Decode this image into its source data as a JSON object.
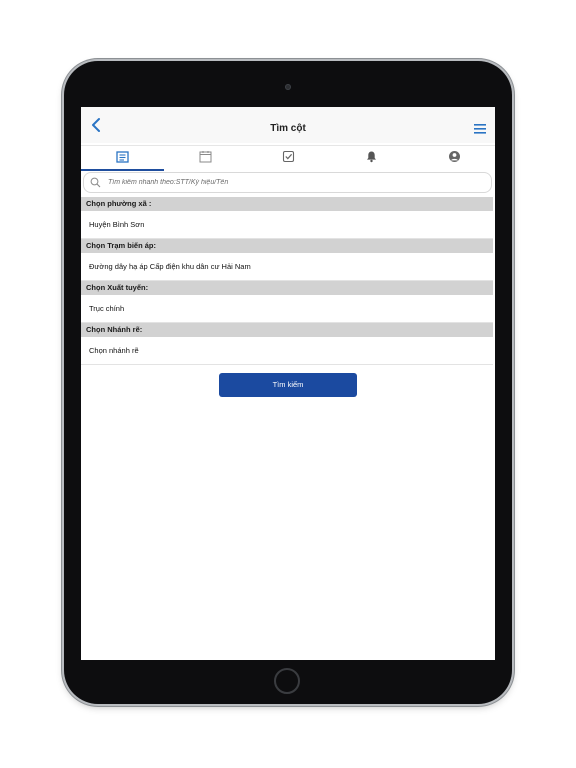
{
  "header": {
    "title": "Tìm cột",
    "back_icon": "chevron-left-icon",
    "menu_icon": "hamburger-menu-icon"
  },
  "tabs": [
    {
      "icon": "document-list-icon",
      "active": true
    },
    {
      "icon": "calendar-icon",
      "active": false
    },
    {
      "icon": "checkbox-icon",
      "active": false
    },
    {
      "icon": "bell-icon",
      "active": false
    },
    {
      "icon": "user-circle-icon",
      "active": false
    }
  ],
  "search": {
    "placeholder": "Tìm kiếm nhanh theo:STT/Ký hiệu/Tên",
    "value": ""
  },
  "fields": [
    {
      "label": "Chọn phường xã :",
      "value": "Huyện Bình Sơn"
    },
    {
      "label": "Chọn Trạm biến áp:",
      "value": "Đường dây hạ áp Cấp điện khu dân cư Hải Nam"
    },
    {
      "label": "Chọn Xuất tuyến:",
      "value": "Trục chính"
    },
    {
      "label": "Chọn Nhánh rẽ:",
      "value": "Chọn nhánh rẽ"
    }
  ],
  "search_button": {
    "label": "Tìm kiếm"
  },
  "colors": {
    "accent": "#1b4aa0",
    "section_bg": "#d2d2d2",
    "icon_blue": "#2a74c4",
    "icon_gray": "#8a8a8a"
  }
}
